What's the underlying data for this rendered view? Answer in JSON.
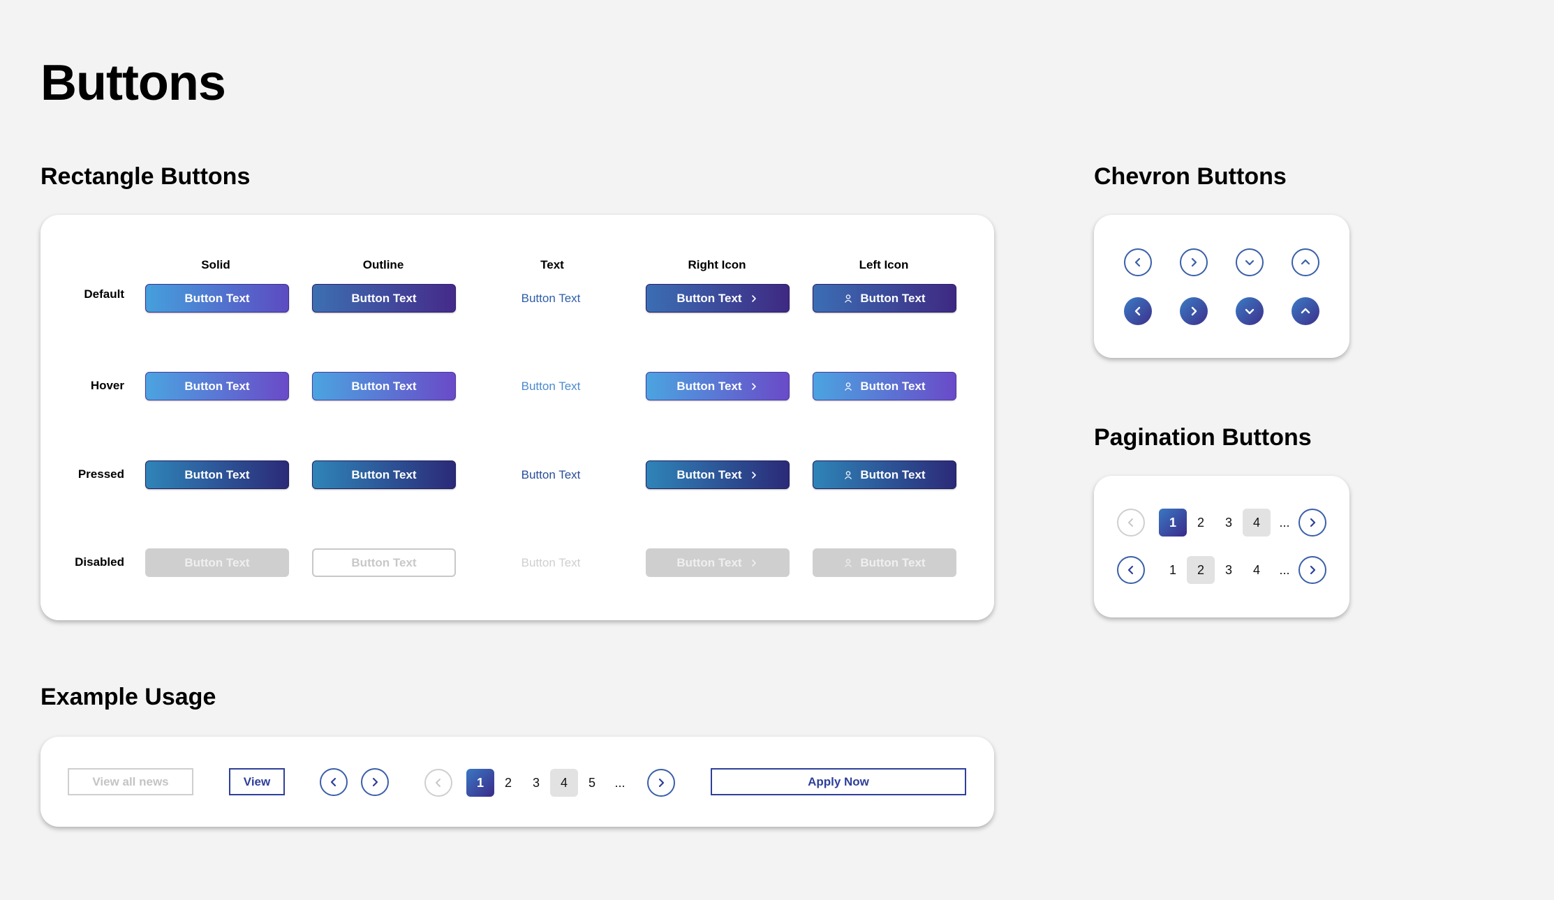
{
  "page": {
    "title": "Buttons"
  },
  "sections": {
    "rectangle": "Rectangle Buttons",
    "chevron": "Chevron Buttons",
    "pagination": "Pagination Buttons",
    "example": "Example Usage"
  },
  "rectangle": {
    "columns": [
      "Solid",
      "Outline",
      "Text",
      "Right Icon",
      "Left Icon"
    ],
    "rows": [
      "Default",
      "Hover",
      "Pressed",
      "Disabled"
    ],
    "button_label": "Button Text"
  },
  "pagination": {
    "row1": [
      "1",
      "2",
      "3",
      "4",
      "..."
    ],
    "row2": [
      "1",
      "2",
      "3",
      "4",
      "..."
    ]
  },
  "example": {
    "view_all": "View all news",
    "view": "View",
    "pages": [
      "1",
      "2",
      "3",
      "4",
      "5",
      "..."
    ],
    "apply": "Apply Now"
  },
  "colors": {
    "background": "#f3f3f3",
    "gradient_start": "#45a0dc",
    "gradient_end": "#5c4bc2",
    "outline_blue": "#3a5fa8",
    "disabled": "#cfcfcf"
  },
  "icons": [
    "chevron-left-icon",
    "chevron-right-icon",
    "chevron-down-icon",
    "chevron-up-icon",
    "user-icon"
  ]
}
